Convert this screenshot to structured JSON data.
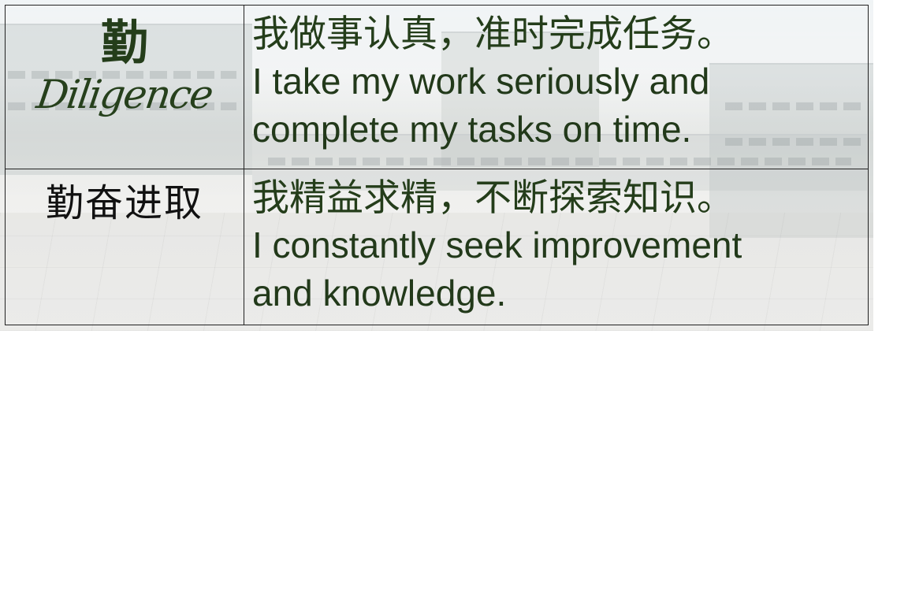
{
  "rows": [
    {
      "character": "勤",
      "script_word": "Diligence",
      "chinese": "我做事认真，准时完成任务。",
      "english_line1": "I take my work seriously and",
      "english_line2": "complete my tasks on time."
    },
    {
      "idiom": "勤奋进取",
      "chinese": "我精益求精，不断探索知识。",
      "english_line1": "I constantly seek improvement",
      "english_line2": "and knowledge."
    }
  ],
  "colors": {
    "text_green": "#243d1a",
    "border": "#222222"
  }
}
